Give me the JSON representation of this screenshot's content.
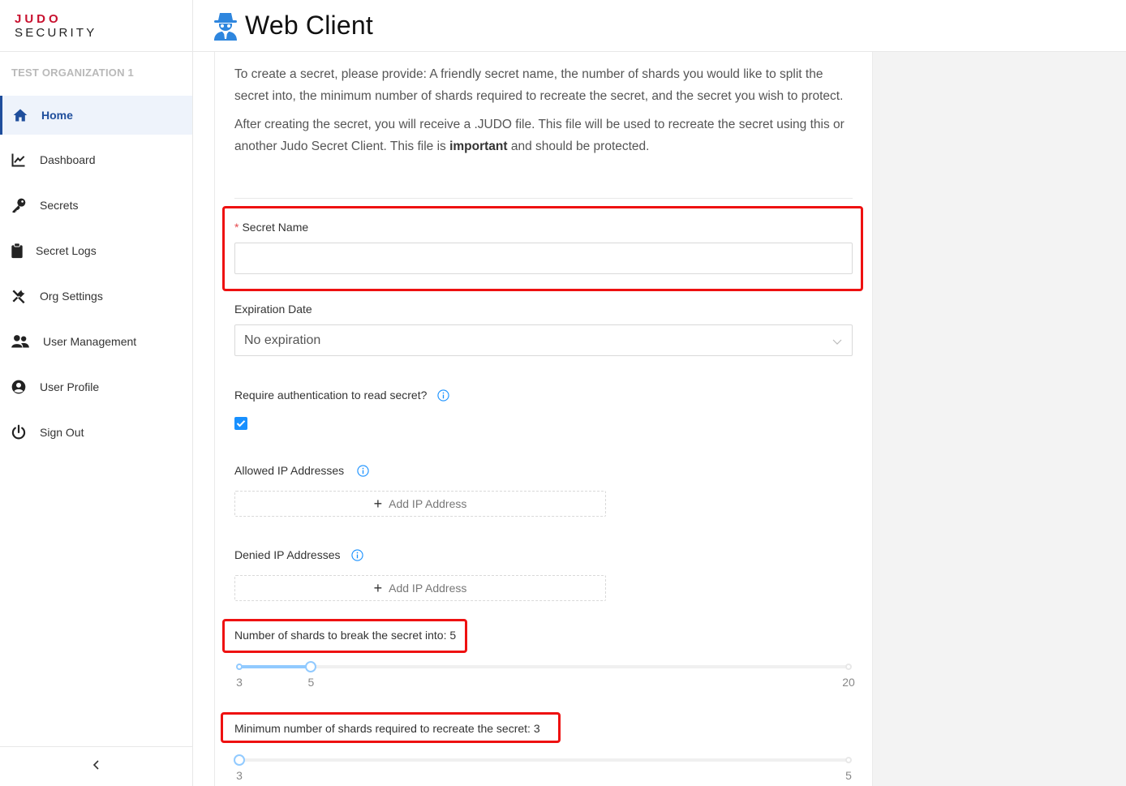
{
  "brand": {
    "logo_top": "JUDO",
    "logo_bottom": "SECURITY"
  },
  "sidebar": {
    "organization": "TEST ORGANIZATION 1",
    "items": [
      {
        "label": "Home",
        "icon": "home-icon",
        "active": true
      },
      {
        "label": "Dashboard",
        "icon": "line-chart-icon"
      },
      {
        "label": "Secrets",
        "icon": "key-icon"
      },
      {
        "label": "Secret Logs",
        "icon": "clipboard-icon"
      },
      {
        "label": "Org Settings",
        "icon": "tools-icon"
      },
      {
        "label": "User Management",
        "icon": "users-icon"
      },
      {
        "label": "User Profile",
        "icon": "user-circle-icon"
      },
      {
        "label": "Sign Out",
        "icon": "power-icon"
      }
    ],
    "collapse_icon": "chevron-left-icon"
  },
  "header": {
    "title": "Web Client",
    "icon": "spy-icon"
  },
  "intro": {
    "paragraph1": "To create a secret, please provide: A friendly secret name, the number of shards you would like to split the secret into, the minimum number of shards required to recreate the secret, and the secret you wish to protect.",
    "paragraph2_start": "After creating the secret, you will receive a .JUDO file. This file will be used to recreate the secret using this or another Judo Secret Client. This file is ",
    "paragraph2_bold": "important",
    "paragraph2_end": " and should be protected."
  },
  "form": {
    "secret_name": {
      "label": "Secret Name",
      "required_mark": "*",
      "value": "",
      "placeholder": ""
    },
    "expiration": {
      "label": "Expiration Date",
      "value": "No expiration"
    },
    "require_auth": {
      "label": "Require authentication to read secret?",
      "checked": true
    },
    "allowed_ip": {
      "label": "Allowed IP Addresses",
      "button": "Add IP Address"
    },
    "denied_ip": {
      "label": "Denied IP Addresses",
      "button": "Add IP Address"
    },
    "shards": {
      "label": "Number of shards to break the secret into: 5",
      "min": 3,
      "max": 20,
      "value": 5,
      "min_label": "3",
      "value_label": "5",
      "max_label": "20"
    },
    "min_shards": {
      "label": "Minimum number of shards required to recreate the secret: 3",
      "min": 3,
      "max": 5,
      "value": 3,
      "min_label": "3",
      "max_label": "5"
    }
  },
  "colors": {
    "accent": "#1890ff",
    "brand_red": "#c8102e",
    "highlight": "#ee1111",
    "nav_active": "#1f4e9c"
  }
}
